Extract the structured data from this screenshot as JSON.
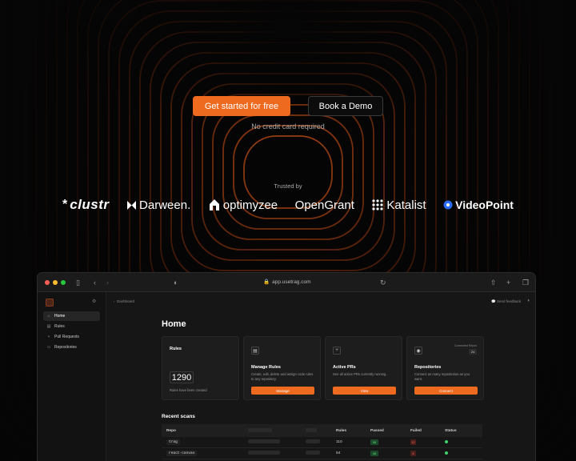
{
  "cta": {
    "primary_label": "Get started for free",
    "secondary_label": "Book a Demo",
    "note": "No credit card required"
  },
  "trusted": {
    "label": "Trusted by",
    "logos": [
      "clustr",
      "Darween.",
      "optimyzee",
      "OpenGrant",
      "Katalist",
      "VideoPoint"
    ]
  },
  "colors": {
    "accent": "#ee6a1f",
    "background": "#050505",
    "passed": "#5fd67e",
    "failed": "#f07060"
  },
  "browser": {
    "url": "app.usetrag.com"
  },
  "sidebar": {
    "items": [
      {
        "label": "Home",
        "icon": "home-icon"
      },
      {
        "label": "Rules",
        "icon": "rules-icon"
      },
      {
        "label": "Pull Requests",
        "icon": "pull-request-icon"
      },
      {
        "label": "Repositories",
        "icon": "folder-icon"
      }
    ]
  },
  "header": {
    "breadcrumb": "Dashboard",
    "feedback_label": "Send feedback"
  },
  "main": {
    "title": "Home",
    "rules_card": {
      "label": "Rules",
      "count": "1290",
      "note": "Rules have been created"
    },
    "cards": [
      {
        "title": "Manage Rules",
        "description": "Create, edit, delete and assign code rules to any repository.",
        "button": "Manage",
        "icon": "rules-doc-icon"
      },
      {
        "title": "Active PRs",
        "description": "See all active PRs currently running.",
        "button": "View",
        "icon": "pull-request-icon"
      },
      {
        "title": "Repositories",
        "description": "Connect as many repositories as you want.",
        "button": "Connect",
        "icon": "github-icon",
        "info_label": "Connected Repos",
        "info_count": "24"
      }
    ],
    "recent_title": "Recent scans",
    "table": {
      "columns": [
        "Repo",
        "",
        "",
        "Rules",
        "Passed",
        "Failed",
        "Status"
      ],
      "rows": [
        {
          "repo": "trag",
          "rules": "110",
          "passed": "98",
          "failed": "12"
        },
        {
          "repo": "react-canvas",
          "rules": "54",
          "passed": "48",
          "failed": "6"
        }
      ]
    }
  }
}
